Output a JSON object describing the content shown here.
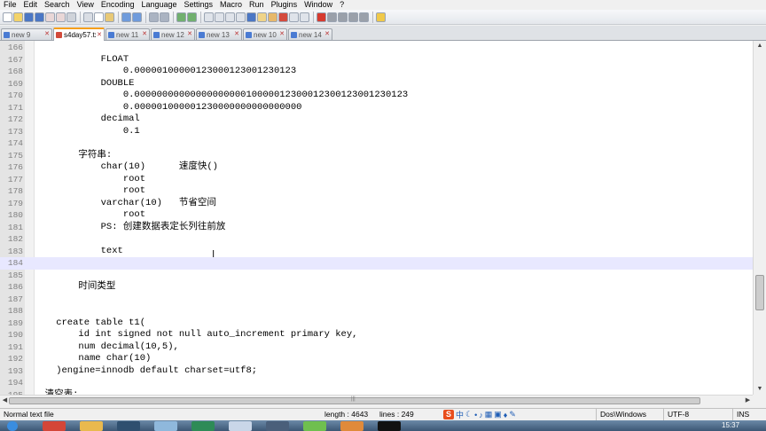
{
  "menu": [
    "File",
    "Edit",
    "Search",
    "View",
    "Encoding",
    "Language",
    "Settings",
    "Macro",
    "Run",
    "Plugins",
    "Window",
    "?"
  ],
  "tabs": [
    {
      "label": "new 9",
      "active": false
    },
    {
      "label": "s4day57.txt",
      "active": true
    },
    {
      "label": "new 11",
      "active": false
    },
    {
      "label": "new 12",
      "active": false
    },
    {
      "label": "new 13",
      "active": false
    },
    {
      "label": "new 10",
      "active": false
    },
    {
      "label": "new 14",
      "active": false
    }
  ],
  "editor": {
    "current_line": "184",
    "lines": [
      {
        "n": "166",
        "text": ""
      },
      {
        "n": "167",
        "text": "            FLOAT"
      },
      {
        "n": "168",
        "text": "                0.00000100000123000123001230123"
      },
      {
        "n": "169",
        "text": "            DOUBLE"
      },
      {
        "n": "170",
        "text": "                0.0000000000000000000010000012300012300123001230123"
      },
      {
        "n": "171",
        "text": "                0.000001000001230000000000000000"
      },
      {
        "n": "172",
        "text": "            decimal"
      },
      {
        "n": "173",
        "text": "                0.1"
      },
      {
        "n": "174",
        "text": ""
      },
      {
        "n": "175",
        "text": "        字符串:"
      },
      {
        "n": "176",
        "text": "            char(10)      速度快()"
      },
      {
        "n": "177",
        "text": "                root"
      },
      {
        "n": "178",
        "text": "                root"
      },
      {
        "n": "179",
        "text": "            varchar(10)   节省空间"
      },
      {
        "n": "180",
        "text": "                root"
      },
      {
        "n": "181",
        "text": "            PS: 创建数据表定长列往前放"
      },
      {
        "n": "182",
        "text": ""
      },
      {
        "n": "183",
        "text": "            text"
      },
      {
        "n": "184",
        "text": ""
      },
      {
        "n": "185",
        "text": ""
      },
      {
        "n": "186",
        "text": "        时间类型"
      },
      {
        "n": "187",
        "text": ""
      },
      {
        "n": "188",
        "text": ""
      },
      {
        "n": "189",
        "text": "    create table t1("
      },
      {
        "n": "190",
        "text": "        id int signed not null auto_increment primary key,"
      },
      {
        "n": "191",
        "text": "        num decimal(10,5),"
      },
      {
        "n": "192",
        "text": "        name char(10)"
      },
      {
        "n": "193",
        "text": "    )engine=innodb default charset=utf8;"
      },
      {
        "n": "194",
        "text": ""
      },
      {
        "n": "195",
        "text": "  清空表:"
      }
    ]
  },
  "status": {
    "type": "Normal text file",
    "length": "length : 4643",
    "lines": "lines : 249",
    "eol": "Dos\\Windows",
    "encoding": "UTF-8",
    "mode": "INS"
  },
  "ime": {
    "logo": "S",
    "lang": "中"
  },
  "clock": "15:37",
  "colors": {
    "active_tab_accent": "#f59f1c",
    "current_line_bg": "#e8e8ff",
    "line_number": "#808080"
  }
}
